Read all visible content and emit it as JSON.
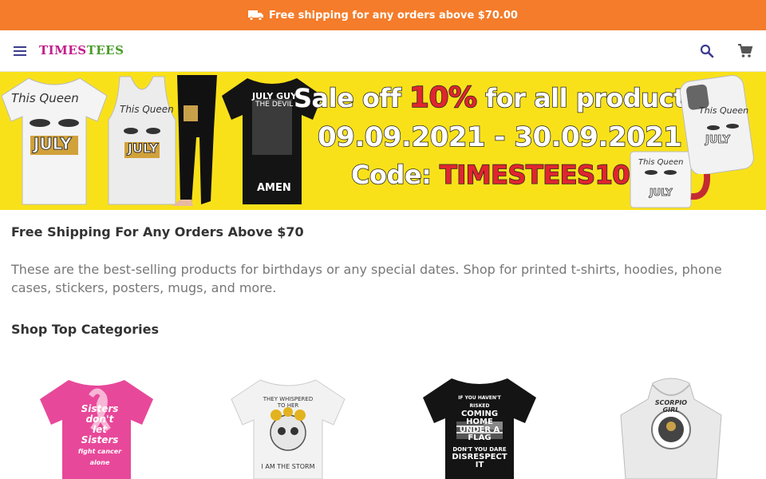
{
  "topbar": {
    "text": "Free shipping for any orders above $70.00",
    "icon": "truck-icon",
    "bg": "#f47c2a"
  },
  "header": {
    "logo_part1": "TIMES",
    "logo_part2": "TEES",
    "icons": [
      "menu-icon",
      "search-icon",
      "cart-icon"
    ]
  },
  "banner": {
    "line1_a": "Sale off ",
    "line1_b": "10%",
    "line1_c": " for all products",
    "line2": "09.09.2021 - 30.09.2021",
    "line3_a": "Code: ",
    "line3_b": "TIMESTEES10",
    "tee1_top": "This Queen",
    "tee1_mid": "JULY",
    "tee2_top": "This Queen",
    "tee2_mid": "JULY",
    "tee3_top": "JULY GUY",
    "tee3_sub": "THE DEVIL",
    "tee3_bottom": "AMEN",
    "case_top": "This Queen",
    "case_mid": "JULY",
    "mug_top": "This Queen",
    "mug_mid": "JULY"
  },
  "content": {
    "shipping_heading": "Free Shipping For Any Orders Above $70",
    "description": "These are the best-selling products for birthdays or any special dates. Shop for printed t-shirts, hoodies, phone cases, stickers, posters, mugs, and more.",
    "categories_heading": "Shop Top Categories"
  },
  "categories": [
    {
      "lines": [
        "Sisters",
        "don't",
        "let",
        "Sisters",
        "fight cancer alone"
      ],
      "color": "#e8489a"
    },
    {
      "lines": [
        "THEY WHISPERED TO HER",
        "I AM THE STORM"
      ],
      "color": "#f2f2f2"
    },
    {
      "lines": [
        "IF YOU HAVEN'T RISKED",
        "COMING HOME",
        "UNDER A FLAG",
        "DON'T YOU DARE",
        "DISRESPECT IT"
      ],
      "color": "#1a1a1a"
    },
    {
      "lines": [
        "SCORPIO GIRL"
      ],
      "color": "#e9e9e9"
    }
  ]
}
